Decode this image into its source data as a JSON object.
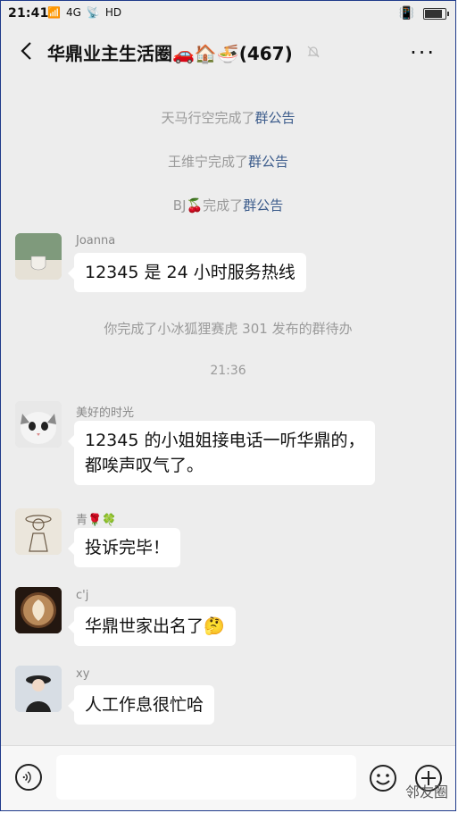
{
  "status": {
    "time": "21:41",
    "signal": "4G",
    "hd": "HD"
  },
  "header": {
    "title": "华鼎业主生活圈🚗🏠🍜(467)"
  },
  "system_messages": [
    {
      "actor": "天马行空完成了",
      "link": "群公告"
    },
    {
      "actor": "王维宁完成了",
      "link": "群公告"
    },
    {
      "actor": "BJ🍒完成了",
      "link": "群公告"
    }
  ],
  "messages": [
    {
      "name": "Joanna",
      "text": "12345 是 24 小时服务热线"
    },
    {
      "name": "美好的时光",
      "line1": "12345 的小姐姐接电话一听华鼎的，",
      "line2": "都唉声叹气了。"
    },
    {
      "name": "青🌹🍀",
      "text": "投诉完毕！"
    },
    {
      "name": "c'j",
      "text": "华鼎世家出名了🤔"
    },
    {
      "name": "xy",
      "text": "人工作息很忙哈"
    }
  ],
  "todo_notice": "你完成了小冰狐狸赛虎 301 发布的群待办",
  "time_label": "21:36",
  "watermark": "邻友圈"
}
